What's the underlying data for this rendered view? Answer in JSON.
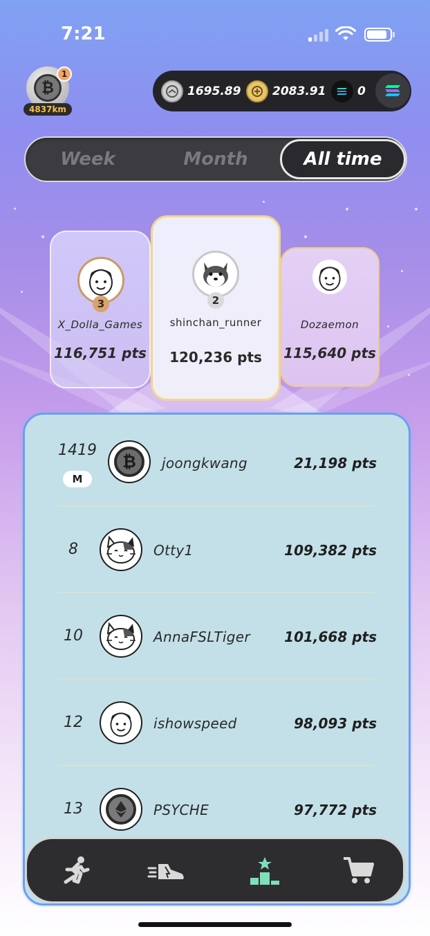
{
  "status": {
    "time": "7:21"
  },
  "profile": {
    "notifications": "1",
    "distance": "4837km"
  },
  "wallet": {
    "items": [
      {
        "icon": "shoe-token-icon",
        "value": "1695.89"
      },
      {
        "icon": "gold-token-icon",
        "value": "2083.91"
      },
      {
        "icon": "solana-icon",
        "value": "0"
      }
    ],
    "chain_button_icon": "solana-icon"
  },
  "tabs": {
    "week": "Week",
    "month": "Month",
    "all_time": "All time",
    "selected": "All time"
  },
  "podium": [
    {
      "rank": "3",
      "name": "X_Dolla_Games",
      "points": "116,751 pts"
    },
    {
      "rank": "2",
      "name": "shinchan_runner",
      "points": "120,236 pts"
    },
    {
      "name": "Dozaemon",
      "points": "115,640 pts"
    }
  ],
  "leaderboard": [
    {
      "rank": "1419",
      "badge": "M",
      "name": "joongkwang",
      "points": "21,198 pts",
      "avatar": "bitcoin-avatar-icon"
    },
    {
      "rank": "8",
      "name": "Otty1",
      "points": "109,382 pts",
      "avatar": "cat-avatar-icon"
    },
    {
      "rank": "10",
      "name": "AnnaFSLTiger",
      "points": "101,668 pts",
      "avatar": "cat-avatar-icon"
    },
    {
      "rank": "12",
      "name": "ishowspeed",
      "points": "98,093 pts",
      "avatar": "face-avatar-icon"
    },
    {
      "rank": "13",
      "name": "PSYCHE",
      "points": "97,772 pts",
      "avatar": "ethereum-avatar-icon"
    }
  ],
  "nav": [
    {
      "icon": "runner-icon"
    },
    {
      "icon": "sneaker-icon"
    },
    {
      "icon": "leaderboard-icon",
      "active": true
    },
    {
      "icon": "cart-icon"
    }
  ],
  "colors": {
    "accent_active": "#7ee0b8",
    "panel": "#c3e0e8",
    "gold_border": "#f3d68c"
  }
}
